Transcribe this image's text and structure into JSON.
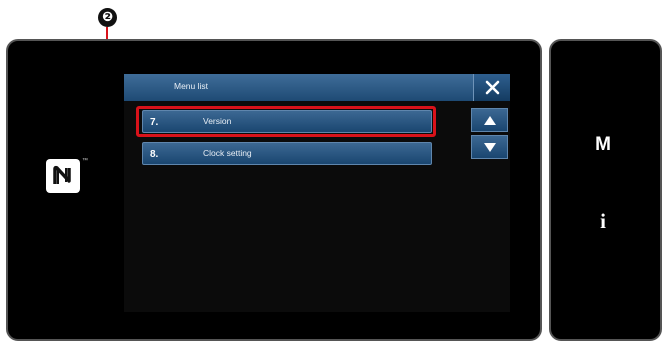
{
  "callout": {
    "number": "❷"
  },
  "panel": {
    "title": "Menu list",
    "close_icon": "close-icon"
  },
  "menu": {
    "items": [
      {
        "number": "7.",
        "label": "Version",
        "selected": true
      },
      {
        "number": "8.",
        "label": "Clock setting",
        "selected": false
      }
    ]
  },
  "scroll": {
    "up_icon": "arrow-up-icon",
    "down_icon": "arrow-down-icon"
  },
  "side_keys": {
    "menu_key": "M",
    "info_key": "i"
  },
  "device": {
    "nfc_mark": "nfc-icon",
    "nfc_tm": "™"
  },
  "colors": {
    "highlight": "#d8121a",
    "button_blue": "#1e4a74",
    "bezel": "#000000"
  }
}
